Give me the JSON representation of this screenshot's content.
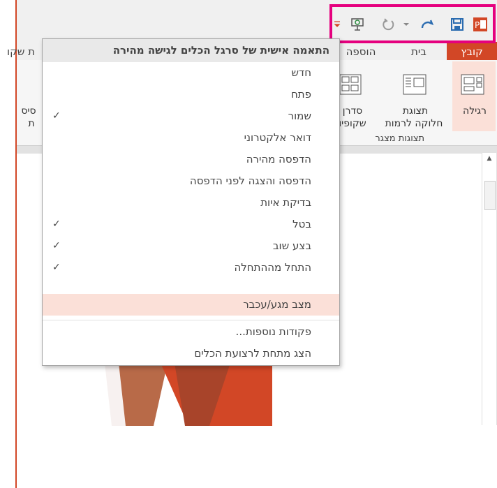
{
  "app": {
    "tabs": [
      {
        "label": "קובץ"
      },
      {
        "label": "בית"
      },
      {
        "label": "הוספה"
      },
      {
        "label": "ת שקו"
      }
    ],
    "ribbon": {
      "normal_label": "רגילה",
      "outline_label": "תצוגת",
      "outline_label2": "חלוקה לרמות",
      "sorter_label": "סדרן",
      "sorter_label2": "שקופיו",
      "side_label": "סיס",
      "side_label2": "ת",
      "group_label": "תצוגות מצגר"
    },
    "colors": {
      "brand": "#d24726",
      "highlight": "#e5007e",
      "menu_hover": "#fbe0d8"
    }
  },
  "menu": {
    "title": "התאמה אישית של סרגל הכלים לגישה מהירה",
    "items": [
      {
        "label": "חדש",
        "checked": false
      },
      {
        "label": "פתח",
        "checked": false
      },
      {
        "label": "שמור",
        "checked": true
      },
      {
        "label": "דואר אלקטרוני",
        "checked": false
      },
      {
        "label": "הדפסה מהירה",
        "checked": false
      },
      {
        "label": "הדפסה והצגה לפני הדפסה",
        "checked": false
      },
      {
        "label": "בדיקת איות",
        "checked": false
      },
      {
        "label": "בטל",
        "checked": true
      },
      {
        "label": "בצע שוב",
        "checked": true
      },
      {
        "label": "התחל מההתחלה",
        "checked": true
      },
      {
        "label": "מצב מגע/עכבר",
        "checked": false
      },
      {
        "label": "פקודות נוספות...",
        "checked": false
      },
      {
        "label": "הצג מתחת לרצועת הכלים",
        "checked": false
      }
    ],
    "check_glyph": "✓"
  },
  "qat": {
    "icons": [
      "powerpoint-icon",
      "save-icon",
      "redo-icon",
      "undo-dropdown-icon",
      "undo-icon",
      "start-from-beginning-icon",
      "qat-customize-dropdown-icon"
    ]
  }
}
